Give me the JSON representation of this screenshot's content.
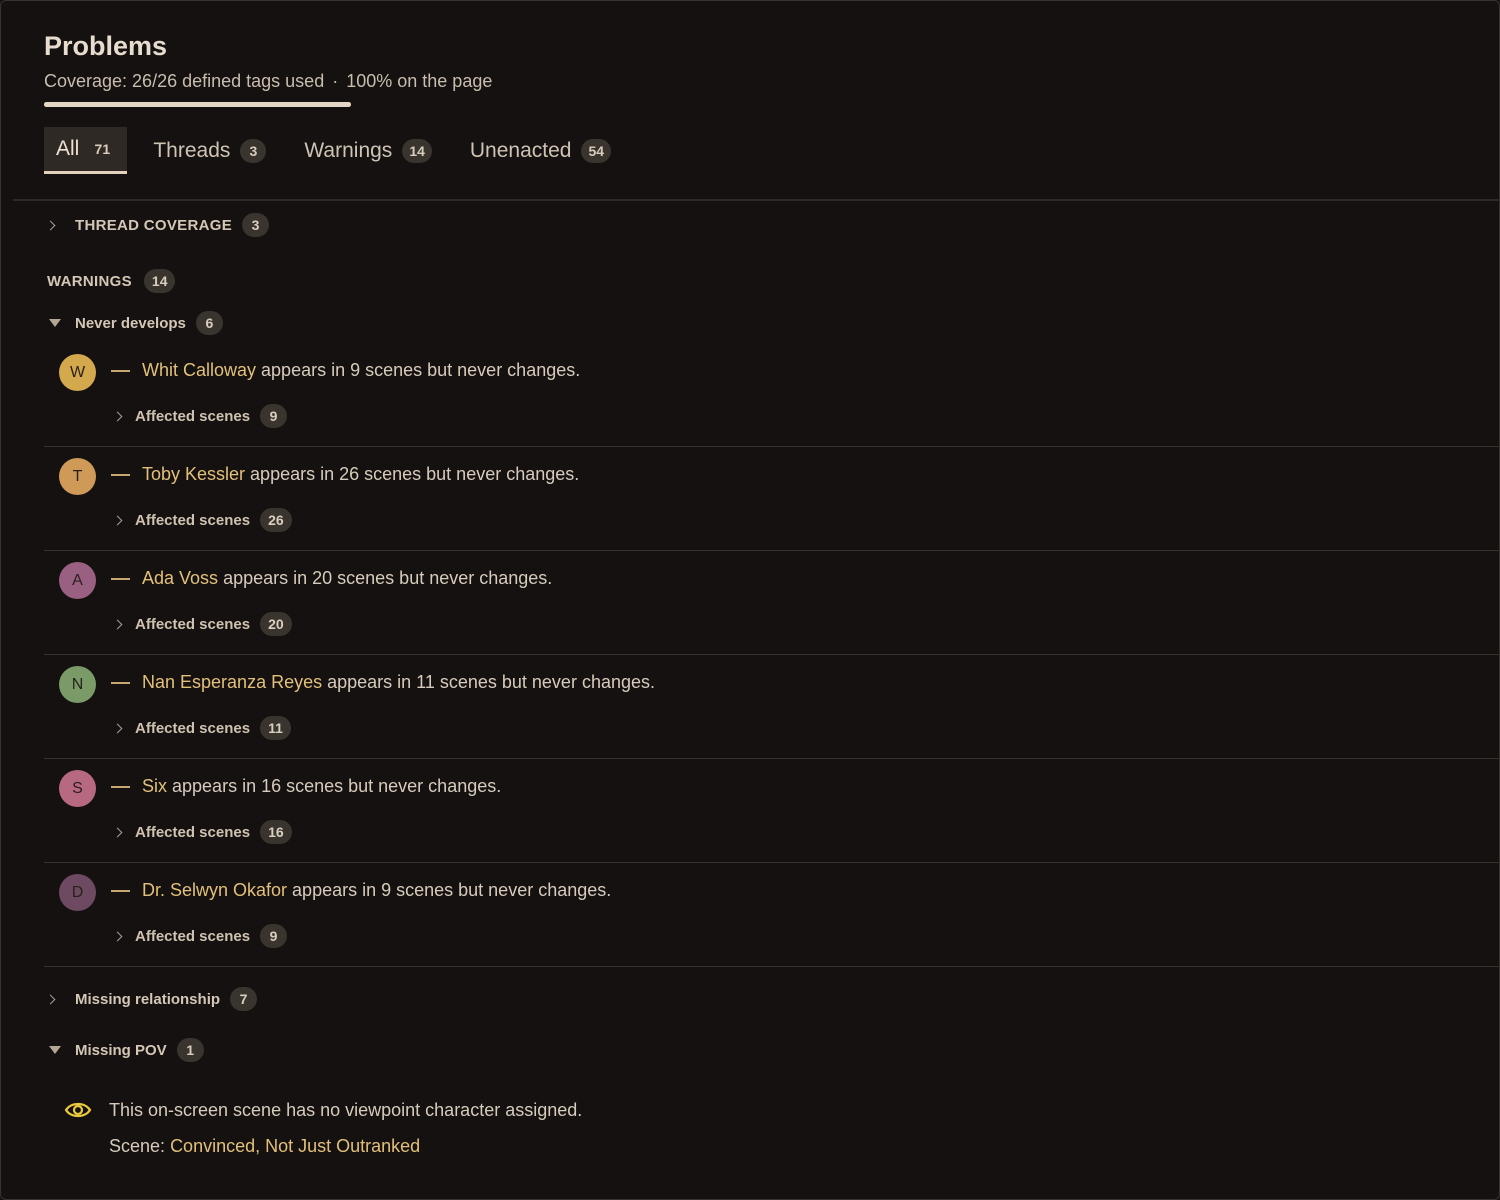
{
  "header": {
    "title": "Problems",
    "coverage_text": "Coverage: 26/26 defined tags used",
    "coverage_sep": "·",
    "coverage_page": "100% on the page",
    "coverage_fraction": 1.0
  },
  "tabs": [
    {
      "label": "All",
      "count": "71",
      "active": true
    },
    {
      "label": "Threads",
      "count": "3",
      "active": false
    },
    {
      "label": "Warnings",
      "count": "14",
      "active": false
    },
    {
      "label": "Unenacted",
      "count": "54",
      "active": false
    }
  ],
  "thread_coverage": {
    "label": "THREAD COVERAGE",
    "count": "3"
  },
  "warnings": {
    "label": "WARNINGS",
    "count": "14"
  },
  "never_develops": {
    "label": "Never develops",
    "count": "6",
    "affected_label": "Affected scenes",
    "items": [
      {
        "initial": "W",
        "name": "Whit Calloway",
        "rest": "appears in 9 scenes but never changes.",
        "scenes": "9",
        "color": "#d4a84c"
      },
      {
        "initial": "T",
        "name": "Toby Kessler",
        "rest": "appears in 26 scenes but never changes.",
        "scenes": "26",
        "color": "#cf9a57"
      },
      {
        "initial": "A",
        "name": "Ada Voss",
        "rest": "appears in 20 scenes but never changes.",
        "scenes": "20",
        "color": "#9a6082"
      },
      {
        "initial": "N",
        "name": "Nan Esperanza Reyes",
        "rest": "appears in 11 scenes but never changes.",
        "scenes": "11",
        "color": "#7a9a68"
      },
      {
        "initial": "S",
        "name": "Six",
        "rest": "appears in 16 scenes but never changes.",
        "scenes": "16",
        "color": "#b86982"
      },
      {
        "initial": "D",
        "name": "Dr. Selwyn Okafor",
        "rest": "appears in 9 scenes but never changes.",
        "scenes": "9",
        "color": "#6e4a62"
      }
    ]
  },
  "missing_relationship": {
    "label": "Missing relationship",
    "count": "7"
  },
  "missing_pov": {
    "label": "Missing POV",
    "count": "1",
    "message": "This on-screen scene has no viewpoint character assigned.",
    "scene_prefix": "Scene:",
    "scene_name": "Convinced, Not Just Outranked",
    "eye_icon_color": "#e8c83e"
  }
}
